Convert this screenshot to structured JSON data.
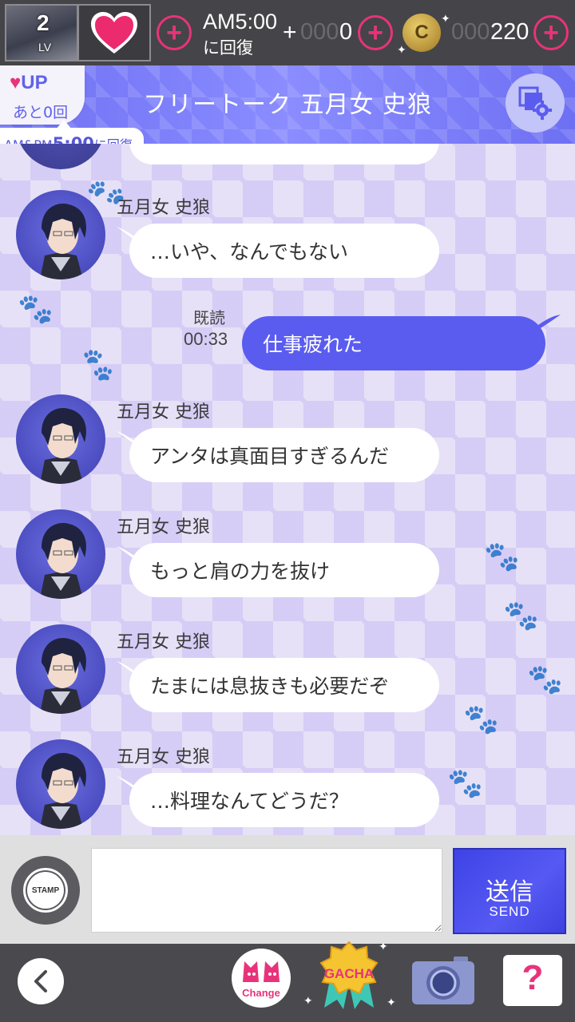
{
  "status": {
    "level": "2",
    "level_label": "LV",
    "recover_time": "AM5:00",
    "recover_label": "に回復",
    "hearts_prefix": "+",
    "hearts_dim": "000",
    "hearts_value": "0",
    "coin_symbol": "C",
    "coins_dim": "000",
    "coins_value": "220"
  },
  "header": {
    "title": "フリートーク 五月女 史狼",
    "up_label": "UP",
    "up_remaining": "あと0回",
    "recover_notice_prefix": "AM&PM",
    "recover_notice_time": "5:00",
    "recover_notice_suffix": "に回復"
  },
  "messages": [
    {
      "sender": "五月女 史狼",
      "text": "…いや、なんでもない"
    },
    {
      "sender": "五月女 史狼",
      "text": "アンタは真面目すぎるんだ"
    },
    {
      "sender": "五月女 史狼",
      "text": "もっと肩の力を抜け"
    },
    {
      "sender": "五月女 史狼",
      "text": "たまには息抜きも必要だぞ"
    },
    {
      "sender": "五月女 史狼",
      "text": "…料理なんてどうだ？"
    }
  ],
  "my_message": {
    "text": "仕事疲れた",
    "read_label": "既読",
    "time": "00:33"
  },
  "input": {
    "stamp_label": "STAMP",
    "value": "",
    "send_label_jp": "送信",
    "send_label_en": "SEND"
  },
  "nav": {
    "change_label": "Change",
    "gacha_label": "GACHA",
    "help_label": "?"
  },
  "colors": {
    "accent": "#5a5cf0",
    "pink": "#e8337a",
    "header": "#7b7df8"
  }
}
